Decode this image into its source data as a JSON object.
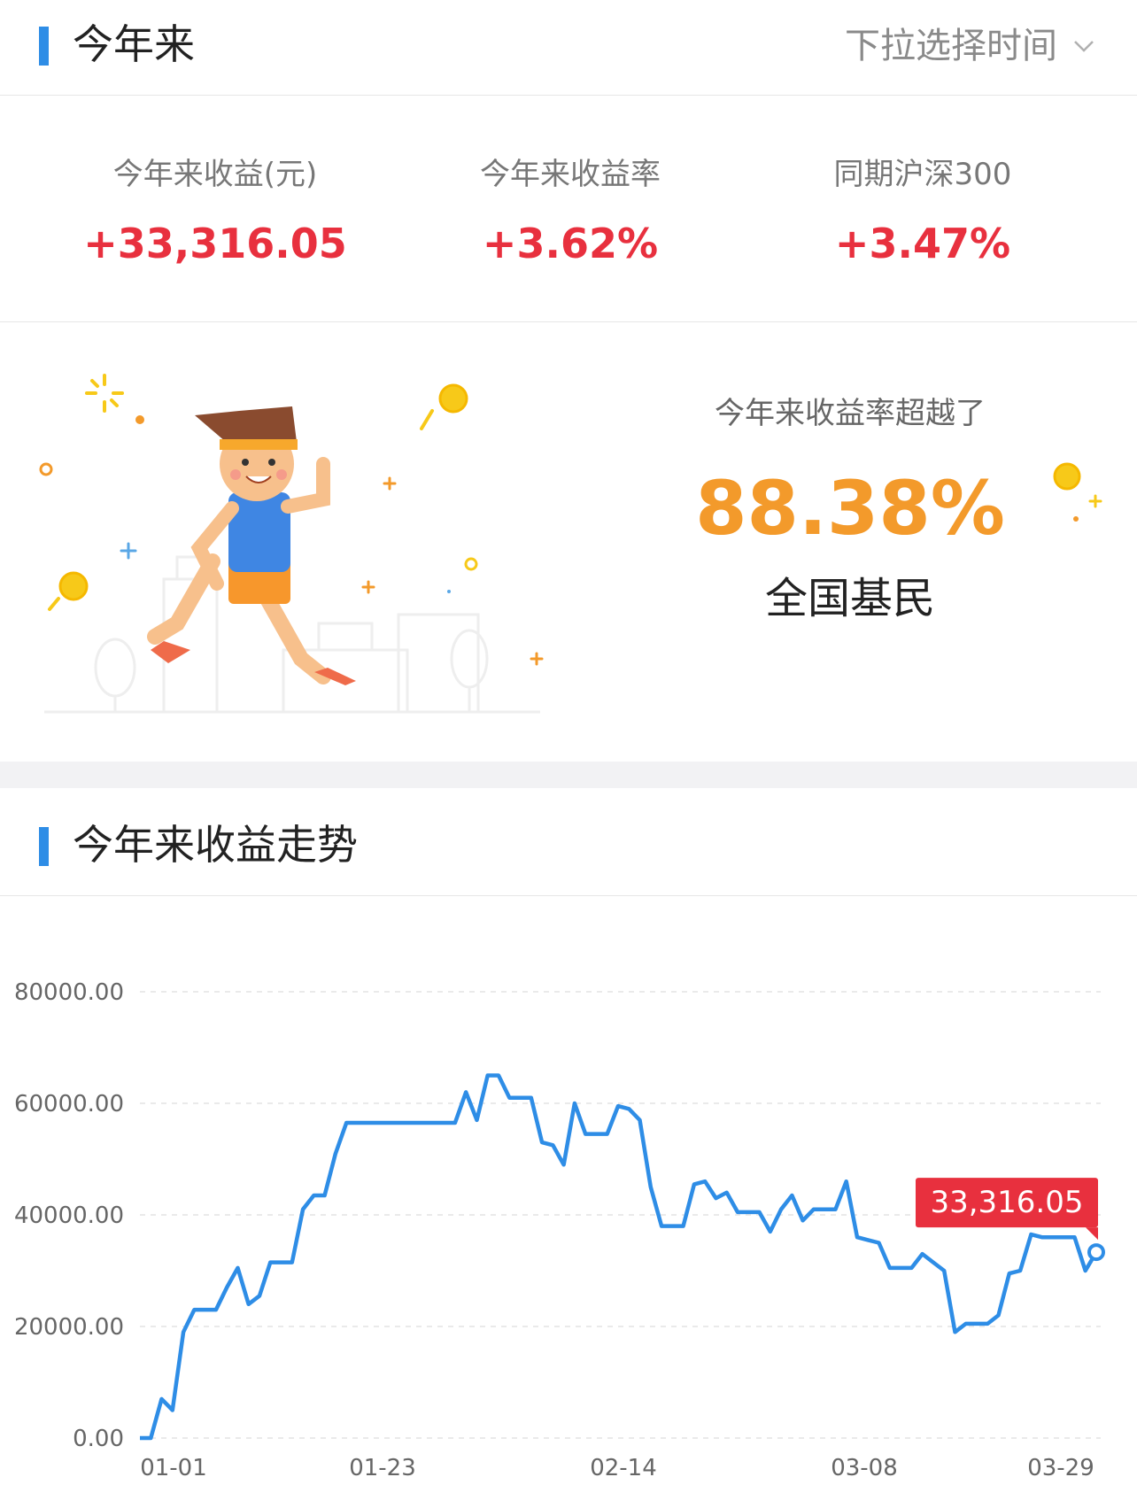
{
  "header": {
    "title": "今年来",
    "dropdown_label": "下拉选择时间",
    "dropdown_icon": "chevron-down-icon"
  },
  "stats": [
    {
      "label": "今年来收益(元)",
      "value": "+33,316.05"
    },
    {
      "label": "今年来收益率",
      "value": "+3.62%"
    },
    {
      "label": "同期沪深300",
      "value": "+3.47%"
    }
  ],
  "ranking": {
    "label": "今年来收益率超越了",
    "percent": "88.38%",
    "subject": "全国基民",
    "illustration": "running-man-illustration"
  },
  "trend": {
    "title": "今年来收益走势"
  },
  "colors": {
    "accent_blue": "#2e8de6",
    "gain_red": "#e8303e",
    "rank_orange": "#f39a2b",
    "line_blue": "#2e8de6"
  },
  "chart_data": {
    "type": "line",
    "x_tick_labels": [
      "01-01",
      "01-23",
      "02-14",
      "03-08",
      "03-29"
    ],
    "y_tick_labels": [
      "0.00",
      "20000.00",
      "40000.00",
      "60000.00",
      "80000.00"
    ],
    "ylim": [
      0,
      80000
    ],
    "grid": true,
    "last_value_label": "33,316.05",
    "series": [
      {
        "values": [
          0,
          0,
          7000,
          5000,
          19000,
          23000,
          23000,
          23000,
          27000,
          30500,
          24000,
          25500,
          31500,
          31500,
          31500,
          41000,
          43500,
          43500,
          51000,
          56500,
          56500,
          56500,
          56500,
          56500,
          56500,
          56500,
          56500,
          56500,
          56500,
          56500,
          62000,
          57000,
          65000,
          65000,
          61000,
          61000,
          61000,
          53000,
          52500,
          49000,
          60000,
          54500,
          54500,
          54500,
          59500,
          59000,
          57000,
          45000,
          38000,
          38000,
          38000,
          45500,
          46000,
          43000,
          44000,
          40500,
          40500,
          40500,
          37000,
          41000,
          43500,
          39000,
          41000,
          41000,
          41000,
          46000,
          36000,
          35500,
          35000,
          30500,
          30500,
          30500,
          33000,
          31500,
          30000,
          19000,
          20500,
          20500,
          20500,
          22000,
          29500,
          30000,
          36500,
          36000,
          36000,
          36000,
          36000,
          30000,
          33316.05
        ]
      }
    ]
  }
}
